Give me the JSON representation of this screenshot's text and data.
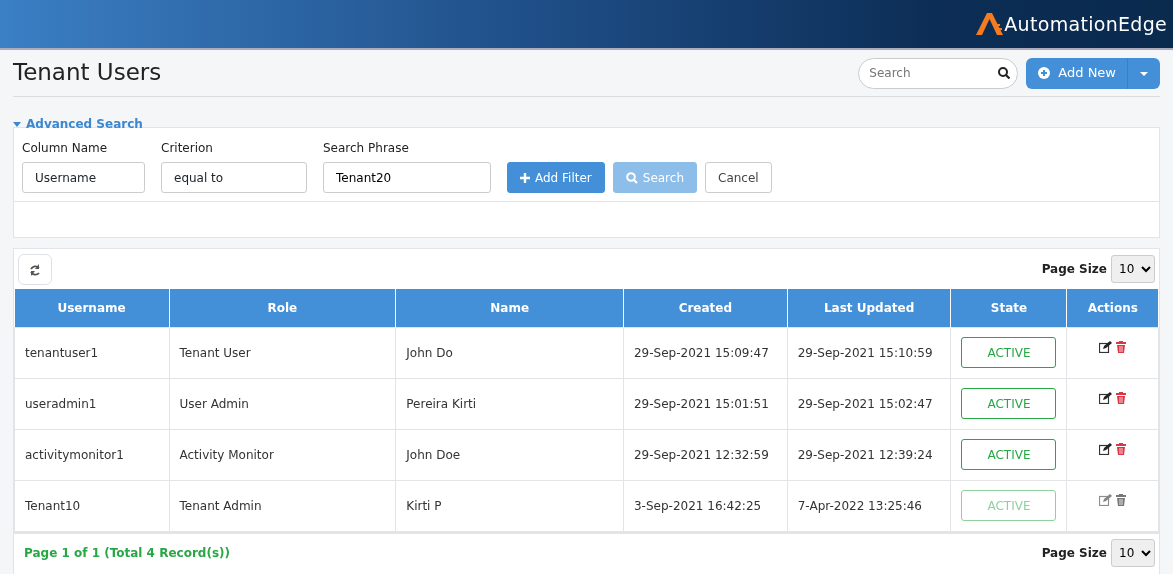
{
  "brand": "AutomationEdge",
  "page_title": "Tenant Users",
  "search": {
    "placeholder": "Search"
  },
  "add_button": "Add New",
  "advanced_search": {
    "label": "Advanced Search",
    "expanded": true,
    "fields": [
      {
        "label": "Column Name",
        "kind": "select",
        "value": "Username"
      },
      {
        "label": "Criterion",
        "kind": "select",
        "value": "equal to"
      },
      {
        "label": "Search Phrase",
        "kind": "input",
        "value": "Tenant20"
      }
    ],
    "buttons": [
      {
        "label": "Add Filter",
        "kind": "primary",
        "disabled": false
      },
      {
        "label": "Search",
        "kind": "primary",
        "disabled": true
      },
      {
        "label": "Cancel",
        "kind": "default",
        "disabled": false
      }
    ]
  },
  "page_size_label": "Page Size",
  "page_size": "10",
  "table": {
    "columns": [
      "Username",
      "Role",
      "Name",
      "Created",
      "Last Updated",
      "State",
      "Actions"
    ],
    "rows": [
      {
        "cells": [
          "tenantuser1",
          "Tenant User",
          "John Do",
          "29-Sep-2021 15:09:47",
          "29-Sep-2021 15:10:59"
        ],
        "state": "ACTIVE",
        "disabled": false
      },
      {
        "cells": [
          "useradmin1",
          "User Admin",
          "Pereira Kirti",
          "29-Sep-2021 15:01:51",
          "29-Sep-2021 15:02:47"
        ],
        "state": "ACTIVE",
        "disabled": false
      },
      {
        "cells": [
          "activitymonitor1",
          "Activity Monitor",
          "John Doe",
          "29-Sep-2021 12:32:59",
          "29-Sep-2021 12:39:24"
        ],
        "state": "ACTIVE",
        "disabled": false
      },
      {
        "cells": [
          "Tenant10",
          "Tenant Admin",
          "Kirti P",
          "3-Sep-2021 16:42:25",
          "7-Apr-2022 13:25:46"
        ],
        "state": "ACTIVE",
        "disabled": true
      }
    ]
  },
  "footer": {
    "summary": "Page 1 of 1 (Total 4 Record(s))",
    "page_size_label": "Page Size",
    "page_size": "10"
  }
}
